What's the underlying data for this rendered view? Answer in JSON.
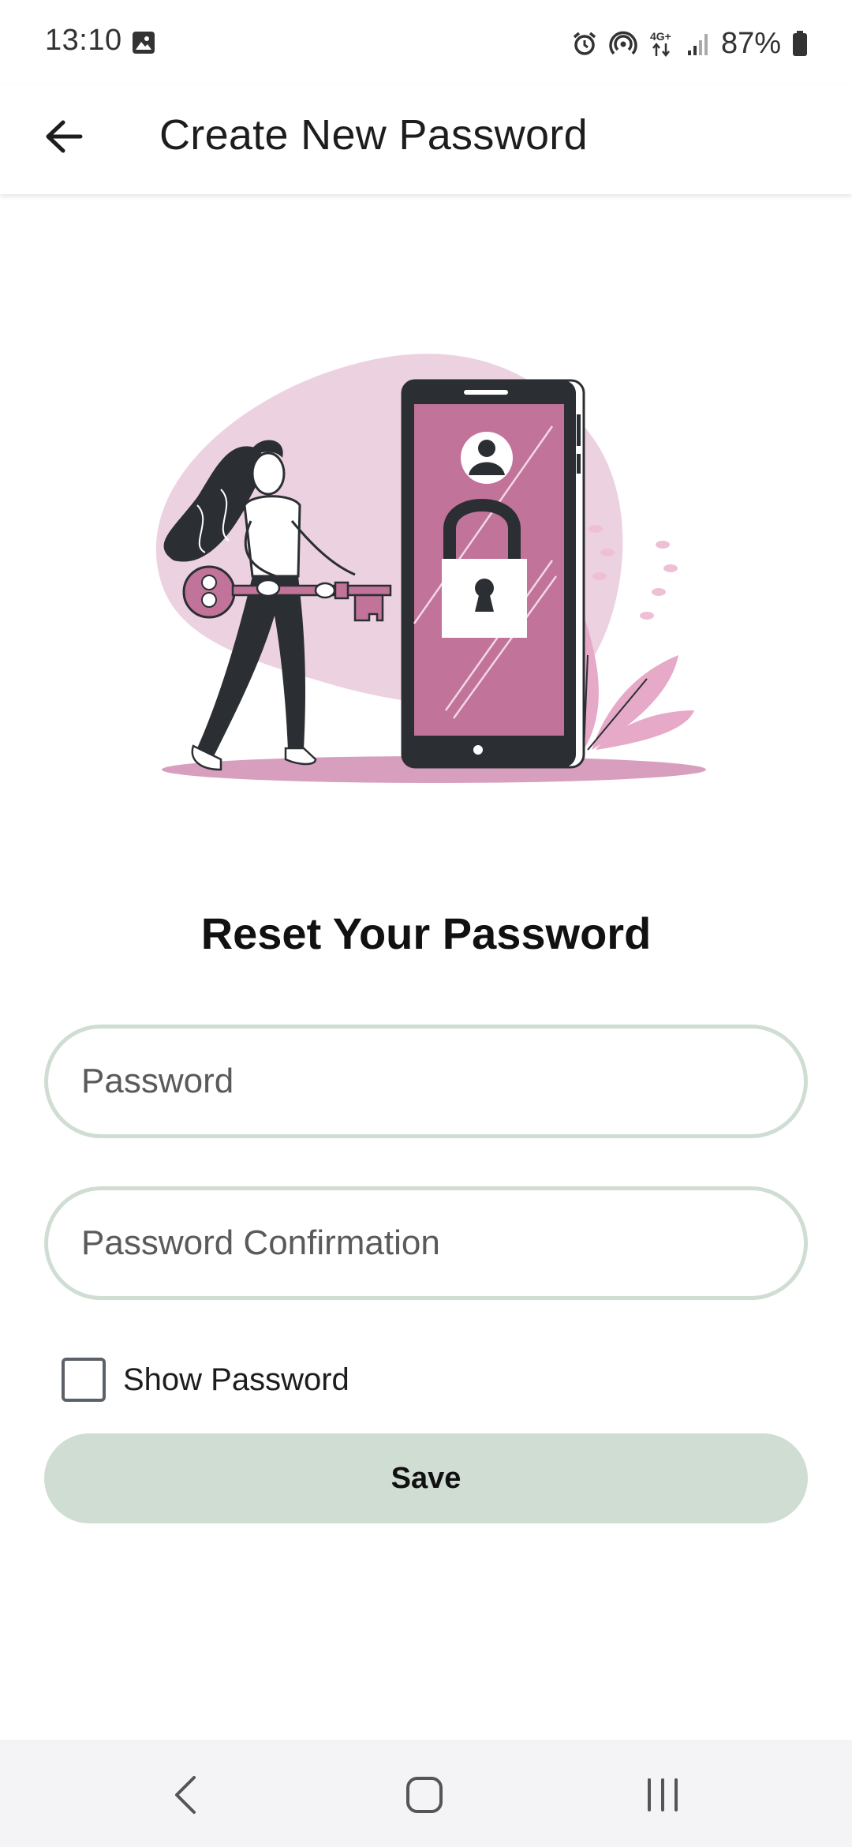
{
  "status_bar": {
    "time": "13:10",
    "battery": "87%",
    "icons": [
      "gallery-icon",
      "alarm-icon",
      "hotspot-icon",
      "network-4g-icon",
      "signal-icon",
      "battery-icon"
    ]
  },
  "app_bar": {
    "title": "Create New Password",
    "back_icon": "arrow-left-icon"
  },
  "illustration": {
    "description_icon": "password-reset-illustration",
    "colors": {
      "accent": "#c2739a",
      "blob": "#ecd2e0",
      "dark": "#2b2f33"
    }
  },
  "form": {
    "heading": "Reset Your Password",
    "password_placeholder": "Password",
    "password_value": "",
    "confirm_placeholder": "Password Confirmation",
    "confirm_value": "",
    "show_password_label": "Show Password",
    "show_password_checked": false,
    "save_label": "Save"
  },
  "colors": {
    "field_border": "#cfddd2",
    "save_button": "#cfddd3",
    "nav_bar": "#f4f4f6"
  },
  "nav_bar": {
    "icons": [
      "nav-back-icon",
      "nav-home-icon",
      "nav-recents-icon"
    ]
  }
}
